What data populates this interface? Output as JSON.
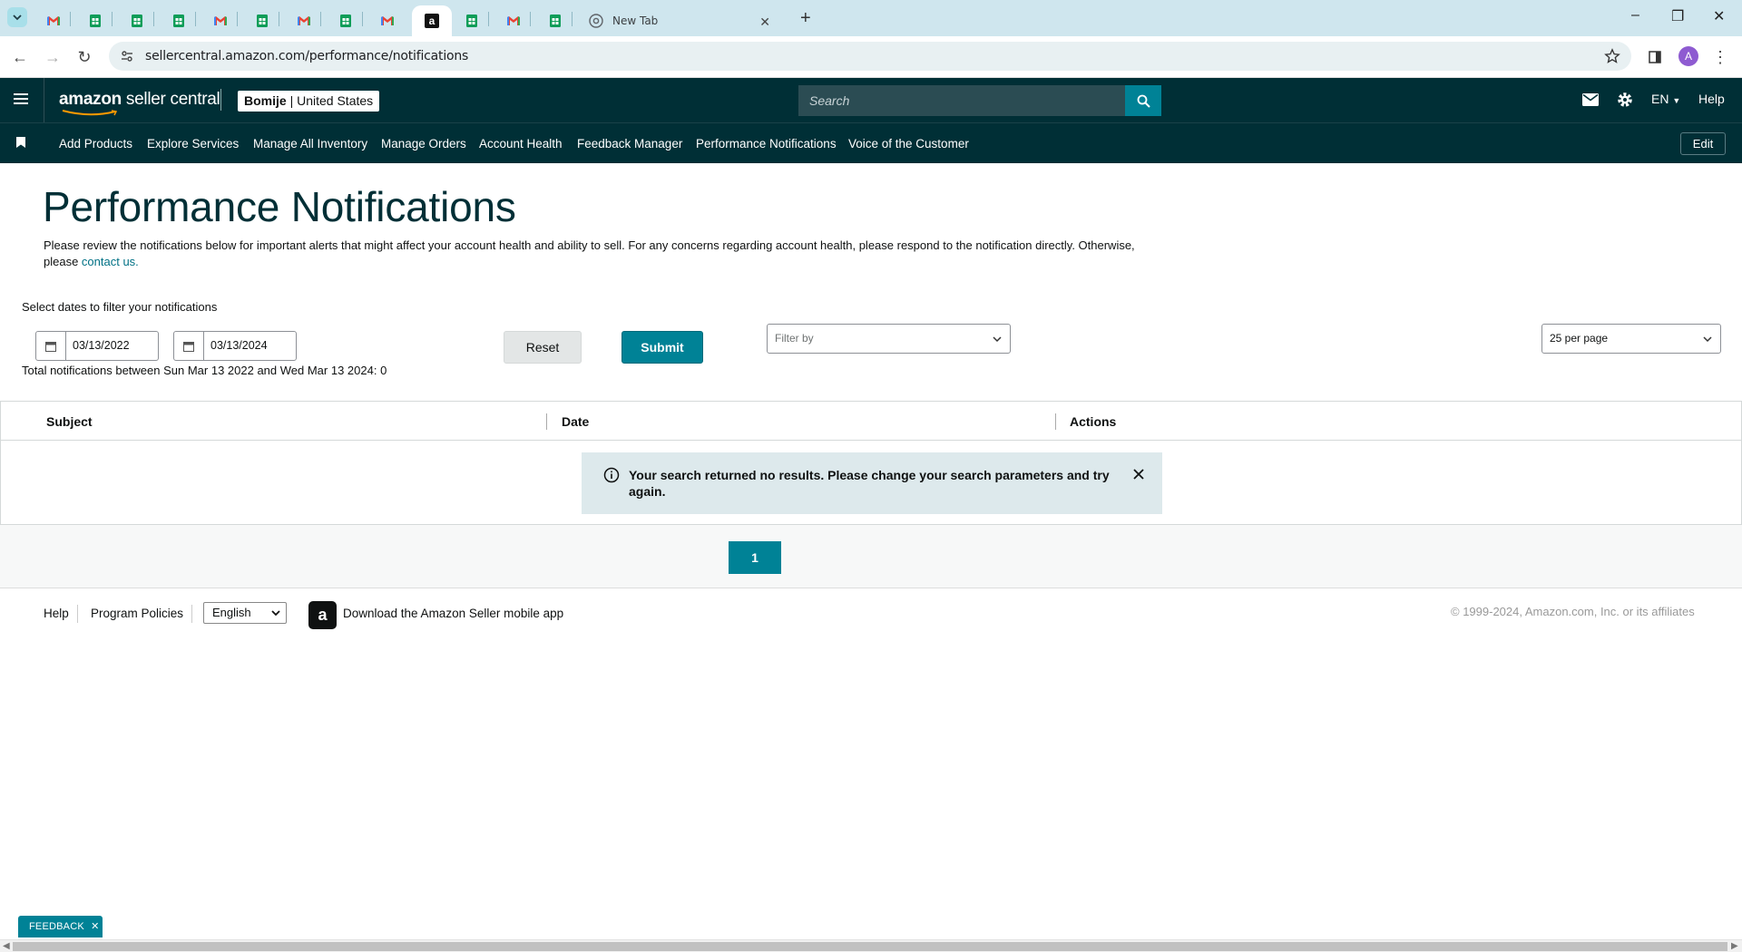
{
  "browser": {
    "tabs": [
      {
        "icon": "gmail-icon"
      },
      {
        "icon": "sheets-icon"
      },
      {
        "icon": "sheets-icon"
      },
      {
        "icon": "sheets-icon"
      },
      {
        "icon": "gmail-icon"
      },
      {
        "icon": "sheets-icon"
      },
      {
        "icon": "gmail-icon"
      },
      {
        "icon": "sheets-icon"
      },
      {
        "icon": "gmail-icon"
      },
      {
        "icon": "amazon-icon",
        "active": true
      },
      {
        "icon": "sheets-icon"
      },
      {
        "icon": "gmail-icon"
      },
      {
        "icon": "sheets-icon"
      },
      {
        "icon": "chrome-icon",
        "title": "New Tab"
      }
    ],
    "url": "sellercentral.amazon.com/performance/notifications",
    "profile_initial": "A"
  },
  "header": {
    "logo_amazon": "amazon",
    "logo_rest": " seller central",
    "account_name": "Bomije",
    "account_region": " | United States",
    "search_placeholder": "Search",
    "language": "EN",
    "help": "Help"
  },
  "subnav": {
    "links": [
      "Add Products",
      "Explore Services",
      "Manage All Inventory",
      "Manage Orders",
      "Account Health",
      "Feedback Manager",
      "Performance Notifications",
      "Voice of the Customer"
    ],
    "edit": "Edit"
  },
  "main": {
    "title": "Performance Notifications",
    "intro_text": "Please review the notifications below for important alerts that might affect your account health and ability to sell. For any concerns regarding account health, please respond to the notification directly. Otherwise, please ",
    "intro_link": "contact us.",
    "date_label": "Select dates to filter your notifications",
    "start_date": "03/13/2022",
    "end_date": "03/13/2024",
    "reset": "Reset",
    "submit": "Submit",
    "filter_placeholder": "Filter by",
    "per_page": "25 per page",
    "totals": "Total notifications between Sun Mar 13 2022 and Wed Mar 13 2024: 0"
  },
  "table": {
    "columns": [
      "Subject",
      "Date",
      "Actions"
    ],
    "empty_message": "Your search returned no results. Please change your search parameters and try again."
  },
  "pagination": {
    "current_page": "1"
  },
  "footer": {
    "help": "Help",
    "policies": "Program Policies",
    "language": "English",
    "app_text": "Download the Amazon Seller mobile app",
    "copyright": "© 1999-2024, Amazon.com, Inc. or its affiliates"
  },
  "feedback_tab": "FEEDBACK",
  "colors": {
    "header_bg": "#002f36",
    "accent": "#008296",
    "link": "#007185",
    "alert_bg": "#dde9ec"
  }
}
